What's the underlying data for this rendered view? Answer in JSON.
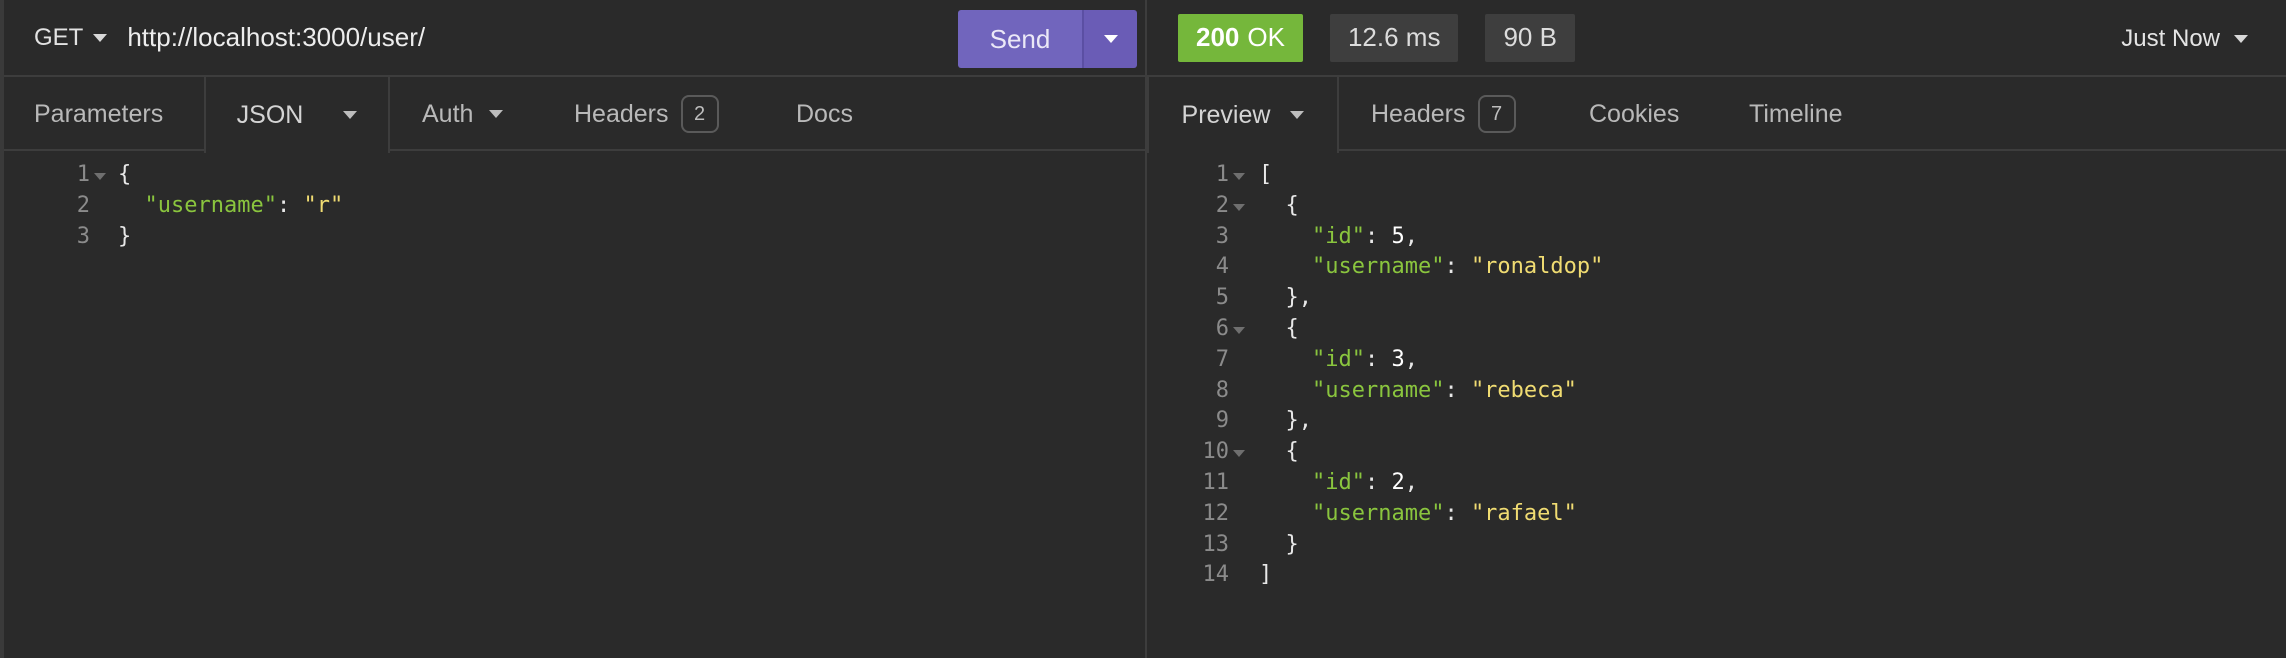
{
  "request": {
    "method": "GET",
    "url": "http://localhost:3000/user/",
    "send_label": "Send",
    "tabs": [
      {
        "label": "Parameters"
      },
      {
        "label": "JSON"
      },
      {
        "label": "Auth"
      },
      {
        "label": "Headers",
        "count": "2"
      },
      {
        "label": "Docs"
      }
    ],
    "body_lines": [
      {
        "n": "1",
        "segments": [
          {
            "t": "{",
            "c": "p"
          }
        ]
      },
      {
        "n": "2",
        "segments": [
          {
            "t": "  ",
            "c": "p"
          },
          {
            "t": "\"username\"",
            "c": "k"
          },
          {
            "t": ": ",
            "c": "p"
          },
          {
            "t": "\"r\"",
            "c": "s"
          }
        ]
      },
      {
        "n": "3",
        "segments": [
          {
            "t": "}",
            "c": "p"
          }
        ]
      }
    ]
  },
  "response": {
    "status_code": "200",
    "status_text": "OK",
    "time": "12.6 ms",
    "size": "90 B",
    "history_label": "Just Now",
    "tabs": [
      {
        "label": "Preview"
      },
      {
        "label": "Headers",
        "count": "7"
      },
      {
        "label": "Cookies"
      },
      {
        "label": "Timeline"
      }
    ],
    "body_lines": [
      {
        "n": "1",
        "segments": [
          {
            "t": "[",
            "c": "p"
          }
        ]
      },
      {
        "n": "2",
        "segments": [
          {
            "t": "  {",
            "c": "p"
          }
        ]
      },
      {
        "n": "3",
        "segments": [
          {
            "t": "    ",
            "c": "p"
          },
          {
            "t": "\"id\"",
            "c": "k"
          },
          {
            "t": ": ",
            "c": "p"
          },
          {
            "t": "5",
            "c": "n"
          },
          {
            "t": ",",
            "c": "p"
          }
        ]
      },
      {
        "n": "4",
        "segments": [
          {
            "t": "    ",
            "c": "p"
          },
          {
            "t": "\"username\"",
            "c": "k"
          },
          {
            "t": ": ",
            "c": "p"
          },
          {
            "t": "\"ronaldop\"",
            "c": "s"
          }
        ]
      },
      {
        "n": "5",
        "segments": [
          {
            "t": "  },",
            "c": "p"
          }
        ]
      },
      {
        "n": "6",
        "segments": [
          {
            "t": "  {",
            "c": "p"
          }
        ]
      },
      {
        "n": "7",
        "segments": [
          {
            "t": "    ",
            "c": "p"
          },
          {
            "t": "\"id\"",
            "c": "k"
          },
          {
            "t": ": ",
            "c": "p"
          },
          {
            "t": "3",
            "c": "n"
          },
          {
            "t": ",",
            "c": "p"
          }
        ]
      },
      {
        "n": "8",
        "segments": [
          {
            "t": "    ",
            "c": "p"
          },
          {
            "t": "\"username\"",
            "c": "k"
          },
          {
            "t": ": ",
            "c": "p"
          },
          {
            "t": "\"rebeca\"",
            "c": "s"
          }
        ]
      },
      {
        "n": "9",
        "segments": [
          {
            "t": "  },",
            "c": "p"
          }
        ]
      },
      {
        "n": "10",
        "segments": [
          {
            "t": "  {",
            "c": "p"
          }
        ]
      },
      {
        "n": "11",
        "segments": [
          {
            "t": "    ",
            "c": "p"
          },
          {
            "t": "\"id\"",
            "c": "k"
          },
          {
            "t": ": ",
            "c": "p"
          },
          {
            "t": "2",
            "c": "n"
          },
          {
            "t": ",",
            "c": "p"
          }
        ]
      },
      {
        "n": "12",
        "segments": [
          {
            "t": "    ",
            "c": "p"
          },
          {
            "t": "\"username\"",
            "c": "k"
          },
          {
            "t": ": ",
            "c": "p"
          },
          {
            "t": "\"rafael\"",
            "c": "s"
          }
        ]
      },
      {
        "n": "13",
        "segments": [
          {
            "t": "  }",
            "c": "p"
          }
        ]
      },
      {
        "n": "14",
        "segments": [
          {
            "t": "]",
            "c": "p"
          }
        ]
      }
    ]
  },
  "colors": {
    "background": "#2a2a2a",
    "send_button": "#7165bd",
    "status_ok": "#75b73b",
    "json_key": "#8ac53e",
    "json_string": "#f0dc72"
  },
  "icons": {
    "method_dropdown": "chevron-down-icon",
    "send_options": "chevron-down-icon",
    "fold_marker": "fold-arrow-icon"
  }
}
